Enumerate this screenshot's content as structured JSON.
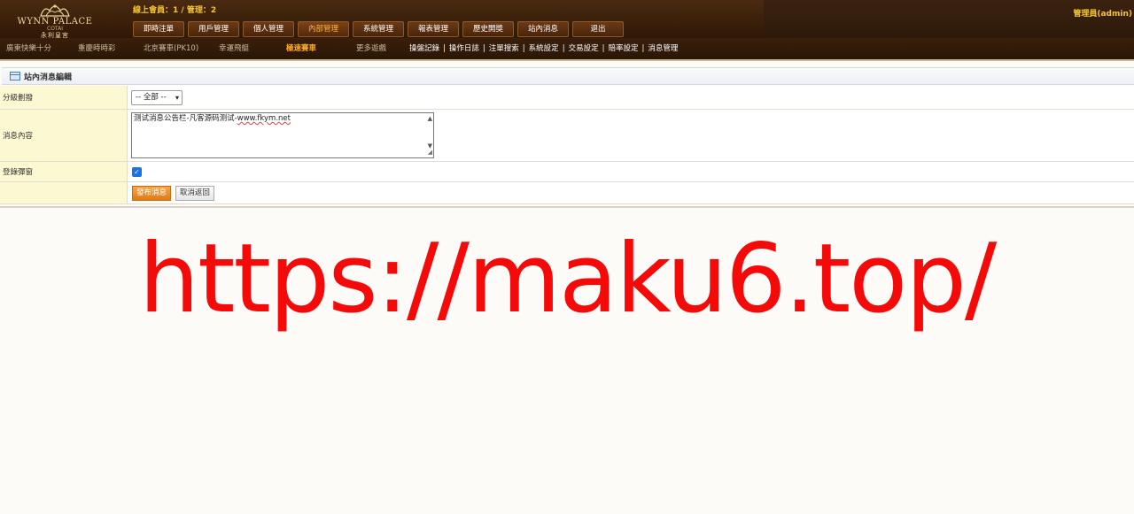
{
  "logo": {
    "name": "WYNN PALACE",
    "sub": "COTAI",
    "cn": "永利皇宮"
  },
  "header": {
    "online_info": "線上會員：1 / 管理：2",
    "admin_info": "管理員(admin)"
  },
  "main_nav": [
    "即時注單",
    "用戶管理",
    "個人管理",
    "內部管理",
    "系統管理",
    "報表管理",
    "歷史開獎",
    "站內消息",
    "退出"
  ],
  "main_nav_active": "內部管理",
  "games": [
    "廣東快樂十分",
    "重慶時時彩",
    "北京賽車(PK10)",
    "幸運飛艇",
    "極速賽車",
    "更多遊戲"
  ],
  "games_active": "極速賽車",
  "sub_links": [
    "操盤記錄",
    "操作日誌",
    "注單搜索",
    "系統設定",
    "交易設定",
    "賠率設定",
    "消息管理"
  ],
  "panel": {
    "title": "站內消息編輯"
  },
  "form": {
    "level_label": "分級劃撥",
    "level_value": "-- 全部 --",
    "content_label": "消息內容",
    "content_prefix": "测试消息公告栏-凡客源码测试-",
    "content_url": "www.fkym.net",
    "popup_label": "登錄彈窗",
    "popup_checked": true,
    "publish_label": "發布消息",
    "cancel_label": "取消返回"
  },
  "watermark": "https://maku6.top/",
  "colors": {
    "accent_gold": "#f4c531",
    "active_orange": "#ffae2a",
    "watermark_red": "#f50a0a",
    "label_bg": "#fbf8d2"
  }
}
